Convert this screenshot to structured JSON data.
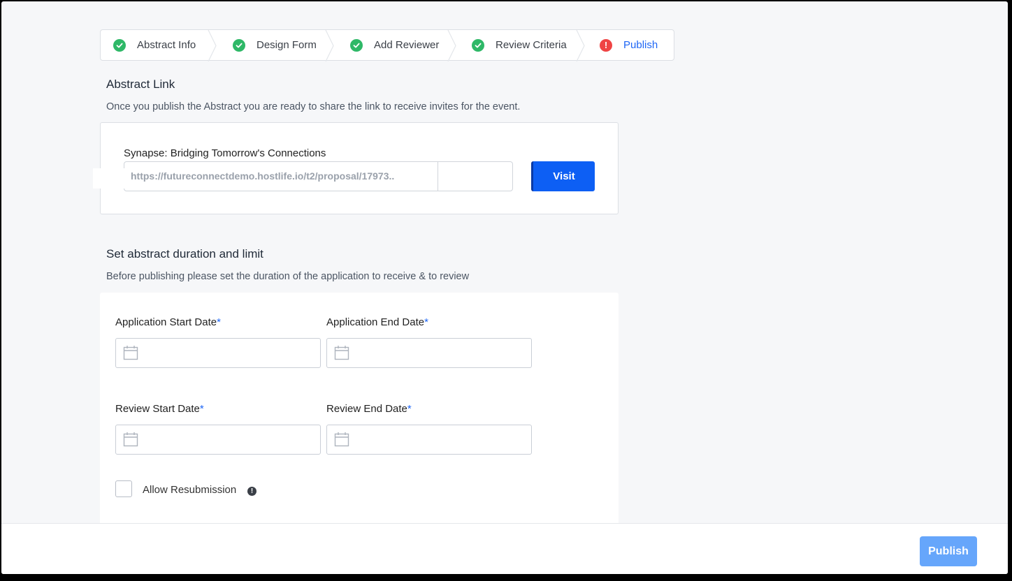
{
  "stepper": {
    "steps": [
      {
        "label": "Abstract Info",
        "status": "complete"
      },
      {
        "label": "Design Form",
        "status": "complete"
      },
      {
        "label": "Add Reviewer",
        "status": "complete"
      },
      {
        "label": "Review Criteria",
        "status": "complete"
      },
      {
        "label": "Publish",
        "status": "error",
        "active": true
      }
    ]
  },
  "abstract_link": {
    "title": "Abstract Link",
    "description": "Once you publish the Abstract you are ready to share the link to receive invites for the event.",
    "event_name": "Synapse: Bridging Tomorrow's Connections",
    "url": "https://futureconnectdemo.hostlife.io/t2/proposal/17973..",
    "visit_label": "Visit"
  },
  "duration": {
    "title": "Set abstract duration and limit",
    "description": "Before publishing please set the duration of the application to receive & to review",
    "fields": {
      "app_start": {
        "label": "Application Start Date",
        "value": ""
      },
      "app_end": {
        "label": "Application End Date",
        "value": ""
      },
      "review_start": {
        "label": "Review Start Date",
        "value": ""
      },
      "review_end": {
        "label": "Review End Date",
        "value": ""
      }
    },
    "required_mark": "*",
    "allow_resubmission": {
      "label": "Allow Resubmission",
      "checked": false
    }
  },
  "footer": {
    "publish_label": "Publish"
  },
  "colors": {
    "primary": "#0d5ff4",
    "success": "#2eb867",
    "error": "#ef4444",
    "publish_disabled": "#66a6fb"
  }
}
